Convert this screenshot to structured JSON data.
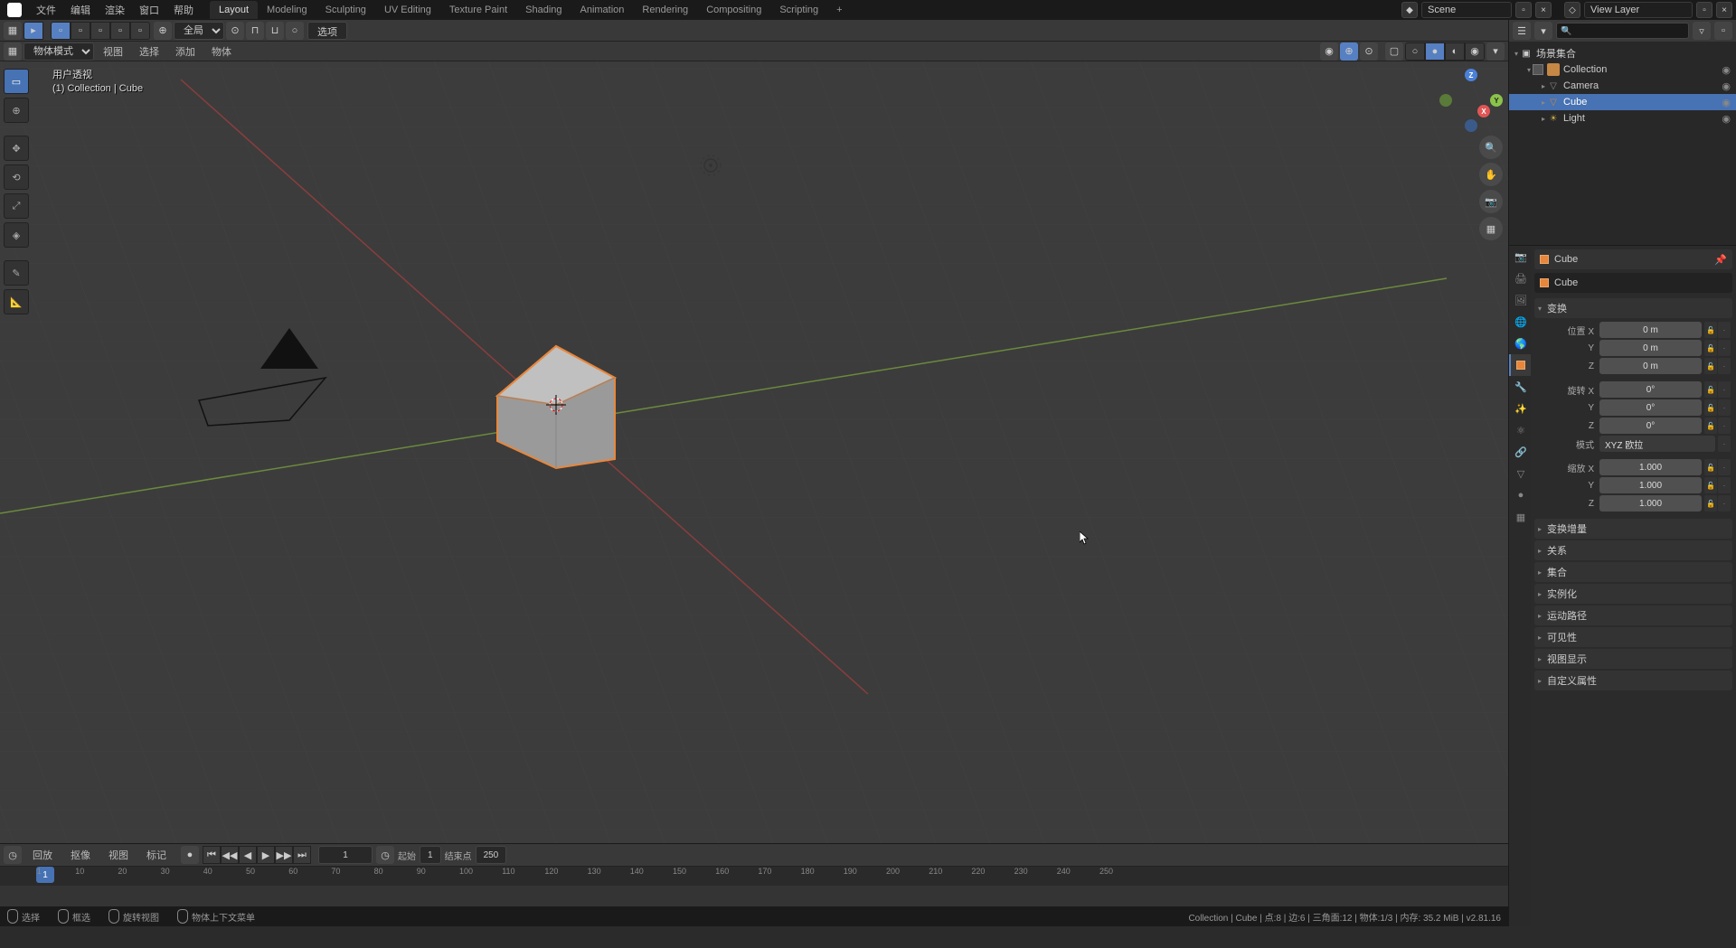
{
  "topbar": {
    "menus": [
      "文件",
      "编辑",
      "渲染",
      "窗口",
      "帮助"
    ],
    "tabs": [
      "Layout",
      "Modeling",
      "Sculpting",
      "UV Editing",
      "Texture Paint",
      "Shading",
      "Animation",
      "Rendering",
      "Compositing",
      "Scripting"
    ],
    "active_tab": "Layout",
    "scene_label": "Scene",
    "viewlayer_label": "View Layer"
  },
  "header2": {
    "mode": "物体模式",
    "menus": [
      "视图",
      "选择",
      "添加",
      "物体"
    ],
    "pivot": "全局",
    "options": "选项"
  },
  "viewport": {
    "overlay_line1": "用户透视",
    "overlay_line2": "(1) Collection | Cube",
    "gizmo": {
      "z": "Z",
      "y": "Y",
      "x": "X"
    }
  },
  "outliner": {
    "title": "场景集合",
    "items": [
      {
        "name": "Collection",
        "type": "collection"
      },
      {
        "name": "Camera",
        "type": "camera"
      },
      {
        "name": "Cube",
        "type": "mesh",
        "selected": true
      },
      {
        "name": "Light",
        "type": "light"
      }
    ]
  },
  "properties": {
    "breadcrumb": "Cube",
    "name": "Cube",
    "panels": {
      "transform": {
        "title": "变换",
        "loc_label": "位置 X",
        "loc_x": "0 m",
        "loc_y": "0 m",
        "loc_z": "0 m",
        "rot_label": "旋转 X",
        "rot_x": "0°",
        "rot_y": "0°",
        "rot_z": "0°",
        "mode_label": "模式",
        "mode_val": "XYZ 欧拉",
        "scale_label": "缩放 X",
        "scale_x": "1.000",
        "scale_y": "1.000",
        "scale_z": "1.000",
        "y": "Y",
        "z": "Z"
      },
      "delta": "变换增量",
      "relations": "关系",
      "collections": "集合",
      "instancing": "实例化",
      "motion": "运动路径",
      "visibility": "可见性",
      "viewdisplay": "视图显示",
      "custom": "自定义属性"
    }
  },
  "timeline": {
    "menus": [
      "回放",
      "抠像",
      "视图",
      "标记"
    ],
    "frame": "1",
    "start_label": "起始",
    "start": "1",
    "end_label": "结束点",
    "end": "250",
    "ticks": [
      1,
      10,
      20,
      30,
      40,
      50,
      60,
      70,
      80,
      90,
      100,
      110,
      120,
      130,
      140,
      150,
      160,
      170,
      180,
      190,
      200,
      210,
      220,
      230,
      240,
      250
    ]
  },
  "statusbar": {
    "select": "选择",
    "boxselect": "框选",
    "rotview": "旋转视图",
    "objmenu": "物体上下文菜单",
    "right": "Collection | Cube | 点:8 | 边:6 | 三角面:12 | 物体:1/3 | 内存: 35.2 MiB | v2.81.16"
  }
}
